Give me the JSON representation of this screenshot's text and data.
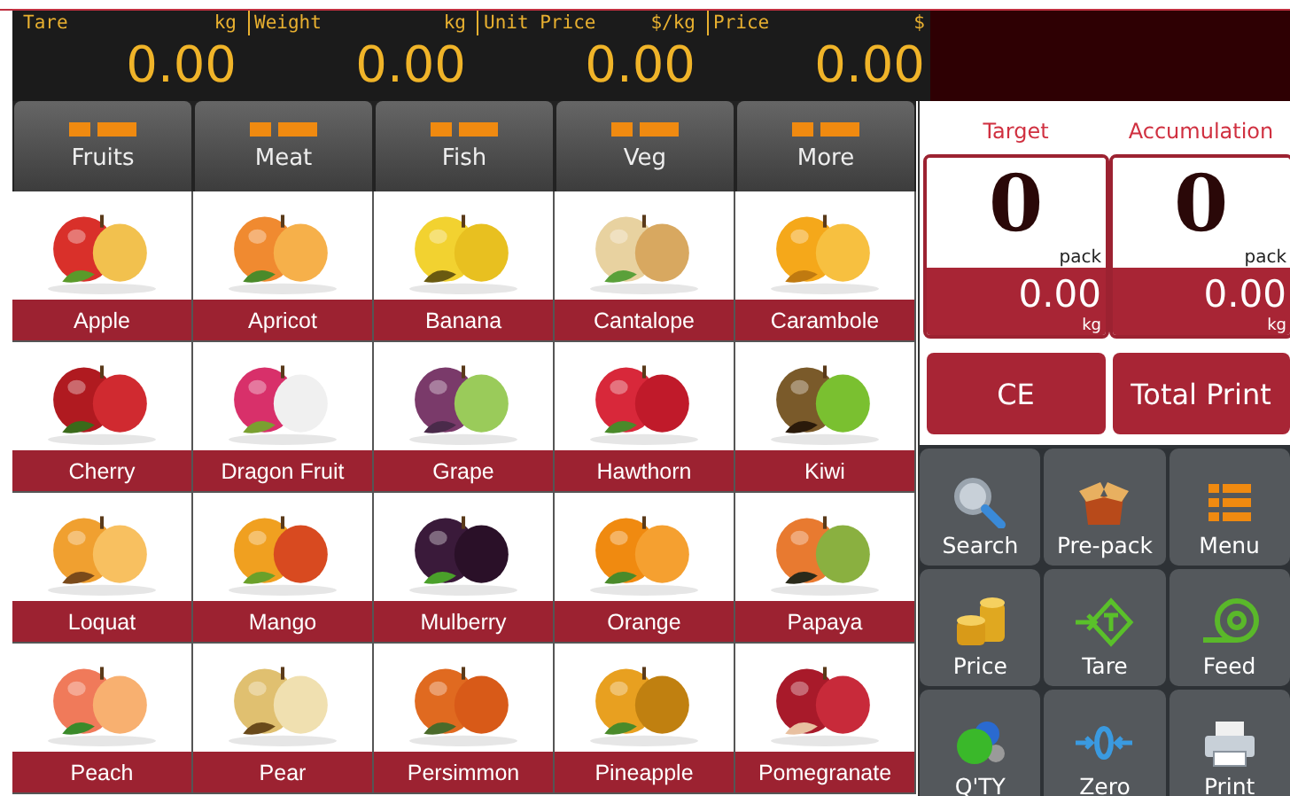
{
  "display": [
    {
      "label": "Tare",
      "unit": "kg",
      "value": "0.00"
    },
    {
      "label": "Weight",
      "unit": "kg",
      "value": "0.00"
    },
    {
      "label": "Unit Price",
      "unit": "$/kg",
      "value": "0.00"
    },
    {
      "label": "Price",
      "unit": "$",
      "value": "0.00"
    }
  ],
  "categories": [
    "Fruits",
    "Meat",
    "Fish",
    "Veg",
    "More"
  ],
  "products": [
    "Apple",
    "Apricot",
    "Banana",
    "Cantalope",
    "Carambole",
    "Cherry",
    "Dragon Fruit",
    "Grape",
    "Hawthorn",
    "Kiwi",
    "Loquat",
    "Mango",
    "Mulberry",
    "Orange",
    "Papaya",
    "Peach",
    "Pear",
    "Persimmon",
    "Pineapple",
    "Pomegranate"
  ],
  "counters": [
    {
      "title": "Target",
      "count": "0",
      "count_unit": "pack",
      "weight": "0.00",
      "weight_unit": "kg"
    },
    {
      "title": "Accumulation",
      "count": "0",
      "count_unit": "pack",
      "weight": "0.00",
      "weight_unit": "kg"
    }
  ],
  "actions": [
    "CE",
    "Total Print"
  ],
  "functions": [
    {
      "kind": "search",
      "label": "Search"
    },
    {
      "kind": "prepack",
      "label": "Pre-pack"
    },
    {
      "kind": "menu",
      "label": "Menu"
    },
    {
      "kind": "price",
      "label": "Price"
    },
    {
      "kind": "tare",
      "label": "Tare"
    },
    {
      "kind": "feed",
      "label": "Feed"
    },
    {
      "kind": "qty",
      "label": "Q'TY"
    },
    {
      "kind": "zero",
      "label": "Zero"
    },
    {
      "kind": "print",
      "label": "Print"
    }
  ]
}
